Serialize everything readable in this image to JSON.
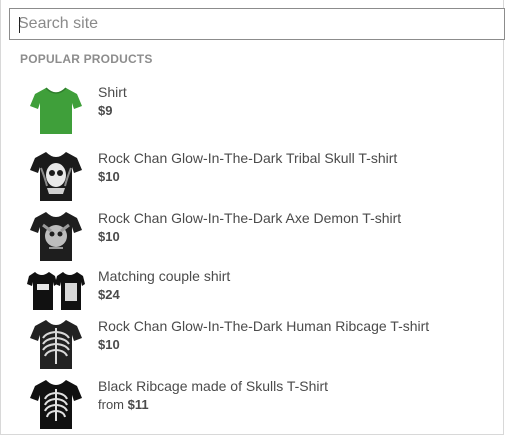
{
  "search": {
    "placeholder": "Search site",
    "value": ""
  },
  "section": {
    "title": "POPULAR PRODUCTS"
  },
  "products": [
    {
      "name": "Shirt",
      "price": "$9",
      "price_prefix": "",
      "icon": "green-tshirt-icon",
      "color": "#3a9a35"
    },
    {
      "name": "Rock Chan Glow-In-The-Dark Tribal Skull T-shirt",
      "price": "$10",
      "price_prefix": "",
      "icon": "tribal-skull-tshirt-icon",
      "color": "#1a1a1a"
    },
    {
      "name": "Rock Chan Glow-In-The-Dark Axe Demon T-shirt",
      "price": "$10",
      "price_prefix": "",
      "icon": "axe-demon-tshirt-icon",
      "color": "#1a1a1a"
    },
    {
      "name": "Matching couple shirt",
      "price": "$24",
      "price_prefix": "",
      "icon": "couple-tshirts-icon",
      "color": "#111111"
    },
    {
      "name": "Rock Chan Glow-In-The-Dark Human Ribcage T-shirt",
      "price": "$10",
      "price_prefix": "",
      "icon": "ribcage-tshirt-icon",
      "color": "#1a1a1a"
    },
    {
      "name": "Black Ribcage made of Skulls T-Shirt",
      "price": "$11",
      "price_prefix": "from",
      "icon": "skull-ribcage-tshirt-icon",
      "color": "#111111"
    }
  ]
}
